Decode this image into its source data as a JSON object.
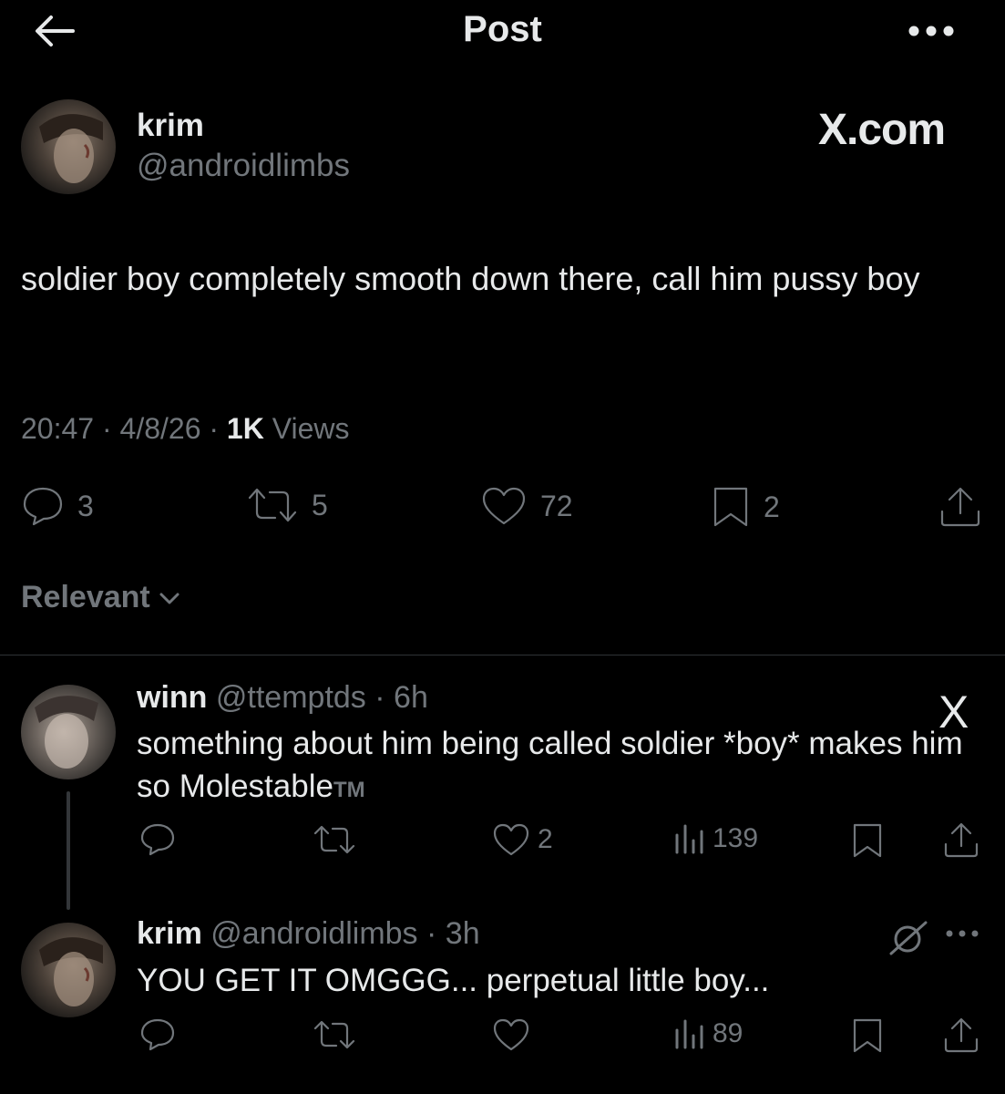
{
  "header": {
    "title": "Post",
    "back_icon": "arrow-left-icon",
    "more_icon": "more-horizontal-icon"
  },
  "post": {
    "name": "krim",
    "handle": "@androidlimbs",
    "source_label": "X.com",
    "text": "soldier boy completely smooth down there, call him pussy boy",
    "meta": {
      "time": "20:47",
      "date": "4/8/26",
      "views_count": "1K",
      "views_label": "Views",
      "sep": "·"
    },
    "stats": {
      "replies": "3",
      "reposts": "5",
      "likes": "72",
      "bookmarks": "2"
    }
  },
  "sort": {
    "label": "Relevant"
  },
  "replies": [
    {
      "name": "winn",
      "handle": "@ttemptds",
      "time": "6h",
      "x_logo": "X",
      "text": "something about him being called soldier *boy* makes him so Molestable",
      "suffix": "TM",
      "stats": {
        "likes": "2",
        "views": "139"
      }
    },
    {
      "name": "krim",
      "handle": "@androidlimbs",
      "time": "3h",
      "text": "YOU GET IT OMGGG... perpetual little boy...",
      "stats": {
        "views": "89"
      }
    }
  ],
  "colors": {
    "background": "#000000",
    "text": "#e7e9ea",
    "muted": "#71767b",
    "divider": "#2f3336"
  }
}
